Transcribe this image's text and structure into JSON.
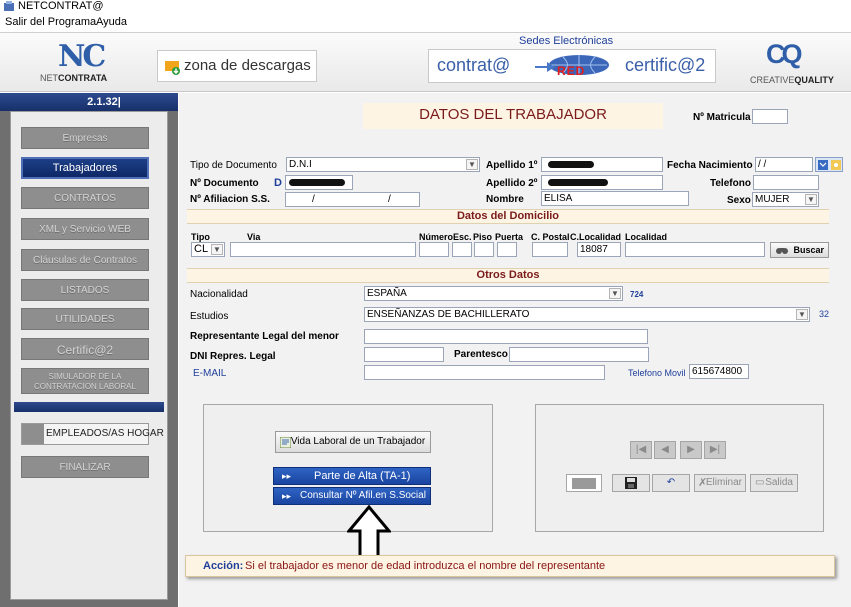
{
  "window": {
    "title": "NETCONTRAT@"
  },
  "menu": [
    "Salir del Programa",
    "Ayuda"
  ],
  "header": {
    "netcontrata_logo_letters": "NC",
    "netcontrata_brand_a": "NET",
    "netcontrata_brand_b": "CONTRATA",
    "zona_a": "zona ",
    "zona_b": "de ",
    "zona_c": "descargas",
    "sedes_title": "Sedes Electrónicas",
    "contrata": "contrat@",
    "red": "RED",
    "certifica": "certific@2",
    "cq_letters": "CQ",
    "creative_a": "CREATIVE",
    "creative_b": "QUALITY"
  },
  "sidebar": {
    "version": "2.1.32|",
    "items": [
      "Empresas",
      "Trabajadores",
      "CONTRATOS",
      "XML y Servicio WEB",
      "Cláusulas de Contratos",
      "LISTADOS",
      "UTILIDADES",
      "Certific@2",
      "SIMULADOR DE LA CONTRATACION LABORAL"
    ],
    "empleados": "EMPLEADOS/AS HOGAR",
    "finalizar": "FINALIZAR"
  },
  "form": {
    "title": "DATOS DEL TRABAJADOR",
    "matricula_label": "Nº Matricula",
    "matricula_value": "",
    "tipo_doc_label": "Tipo de Documento",
    "tipo_doc_value": "D.N.I",
    "num_doc_label": "Nº Documento",
    "num_doc_prefix": "D",
    "afiliacion_label": "Nº Afiliacion S.S.",
    "afiliacion_value_a": "/",
    "afiliacion_value_b": "/",
    "apellido1_label": "Apellido 1º",
    "apellido2_label": "Apellido 2º",
    "nombre_label": "Nombre",
    "nombre_value": "ELISA",
    "fecha_nac_label": "Fecha Nacimiento",
    "fecha_nac_value": "/ /",
    "telefono_label": "Telefono",
    "telefono_value": "",
    "sexo_label": "Sexo",
    "sexo_value": "MUJER"
  },
  "domicilio": {
    "title": "Datos del Domicilio",
    "tipo_label": "Tipo",
    "tipo_value": "CL",
    "via_label": "Via",
    "numero_label": "Número",
    "esc_label": "Esc.",
    "piso_label": "Piso",
    "puerta_label": "Puerta",
    "cpostal_label": "C. Postal",
    "clocalidad_label": "C.Localidad",
    "clocalidad_value": "18087",
    "localidad_label": "Localidad",
    "buscar_label": "Buscar"
  },
  "otros": {
    "title": "Otros Datos",
    "nacionalidad_label": "Nacionalidad",
    "nacionalidad_value": "ESPAÑA",
    "nacionalidad_code": "724",
    "estudios_label": "Estudios",
    "estudios_value": "ENSEÑANZAS DE BACHILLERATO",
    "estudios_code": "32",
    "representante_label": "Representante Legal del menor",
    "dni_repres_label": "DNI Repres. Legal",
    "parentesco_label": "Parentesco",
    "email_label": "E-MAIL",
    "telefono_movil_label": "Telefono Movil",
    "telefono_movil_value": "615674800"
  },
  "actions": {
    "vida_laboral": "Vida Laboral de un Trabajador",
    "parte_alta": "Parte de Alta  (TA-1)",
    "consultar": "Consultar Nº Afil.en S.Social",
    "eliminar": "Eliminar",
    "salida": "Salida"
  },
  "accion": {
    "label": "Acción:",
    "message": "Si el trabajador es menor de edad introduzca el nombre del representante"
  },
  "colors": {
    "accent_blue": "#1a44a0",
    "title_red": "#7b1a1a",
    "sidebar_gray": "#6f6f6f"
  }
}
